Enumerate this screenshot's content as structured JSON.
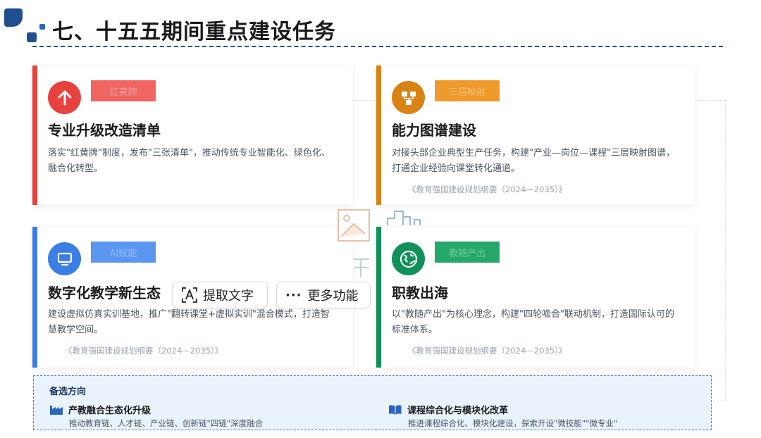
{
  "header": {
    "title": "七、十五五期间重点建设任务"
  },
  "cards": [
    {
      "badge": "红黄牌",
      "title": "专业升级改造清单",
      "desc": "落实\"红黄牌\"制度，发布\"三张清单\"，推动传统专业智能化、绿色化、融合化转型。",
      "ref": "",
      "color": "#e8423f",
      "icon": "arrow-up-icon"
    },
    {
      "badge": "三层映射",
      "title": "能力图谱建设",
      "desc": "对接头部企业典型生产任务，构建\"产业—岗位—课程\"三层映射图谱，打通企业经验向课堂转化通道。",
      "ref": "《教育强国建设规划纲要（2024—2035）》",
      "color": "#d98315",
      "icon": "hierarchy-icon"
    },
    {
      "badge": "AI赋能",
      "title": "数字化教学新生态",
      "desc": "建设虚拟仿真实训基地，推广\"翻转课堂+虚拟实训\"混合模式，打造智慧教学空间。",
      "ref": "《教育强国建设规划纲要（2024—2035）》",
      "color": "#3b7ee6",
      "icon": "monitor-icon"
    },
    {
      "badge": "教随产出",
      "title": "职教出海",
      "desc": "以\"教随产出\"为核心理念，构建\"四轮啮合\"联动机制，打造国际认可的标准体系。",
      "ref": "《教育强国建设规划纲要（2024—2035）》",
      "color": "#10915a",
      "icon": "globe-icon"
    }
  ],
  "toolbar": {
    "extract_label": "提取文字",
    "more_label": "更多功能"
  },
  "alternatives": {
    "title": "备选方向",
    "items": [
      {
        "title": "产教融合生态化升级",
        "desc": "推动教育链、人才链、产业链、创新链\"四链\"深度融合",
        "icon": "factory-icon"
      },
      {
        "title": "课程综合化与模块化改革",
        "desc": "推进课程综合化、模块化建设，探索开设\"微技能\"\"微专业\"",
        "icon": "book-icon"
      }
    ]
  },
  "colors": {
    "primary": "#1f4f8f",
    "red": "#e8423f",
    "orange": "#d98315",
    "blue": "#3b7ee6",
    "green": "#10915a"
  }
}
